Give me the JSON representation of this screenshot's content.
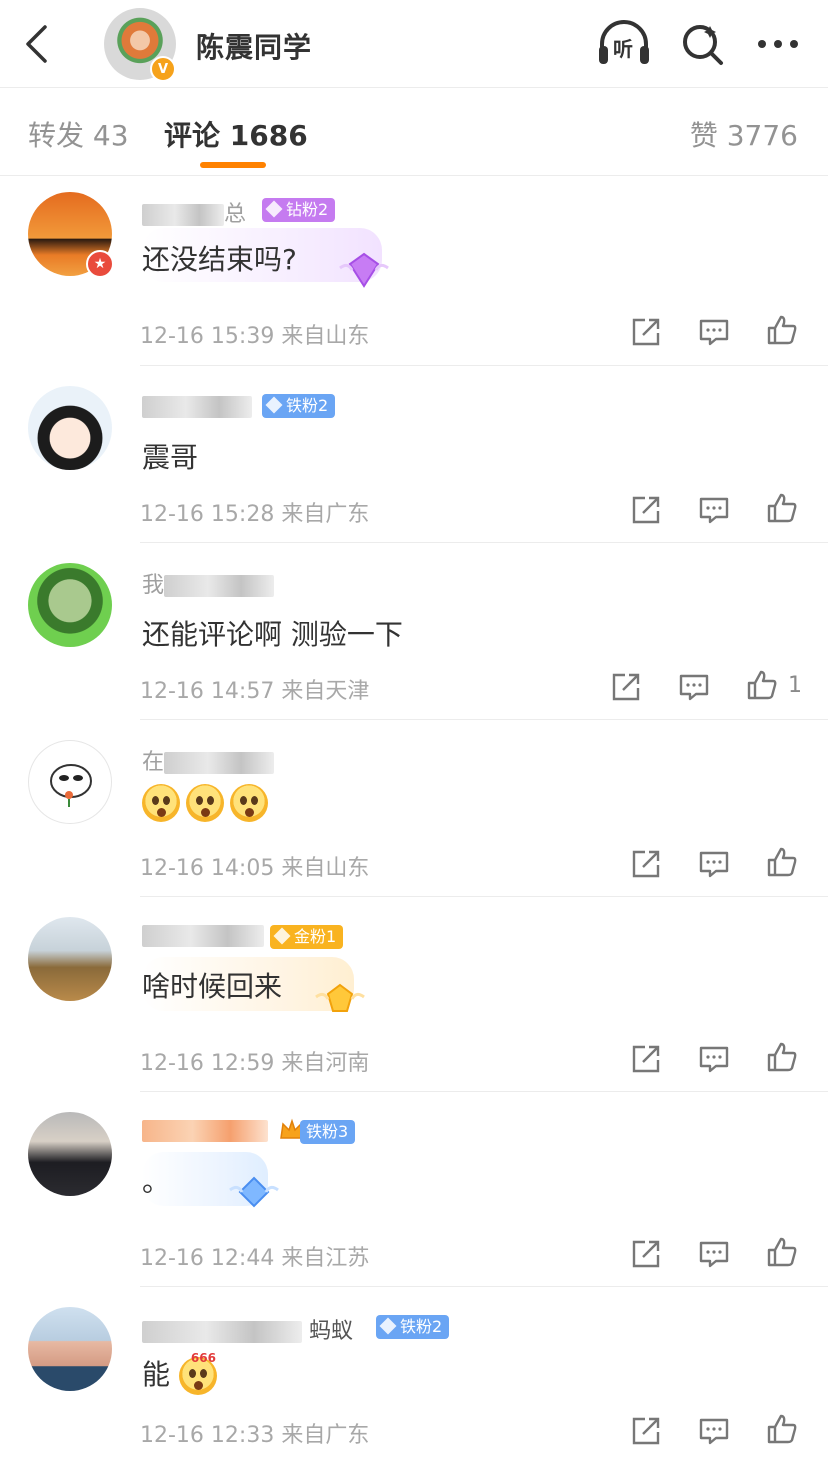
{
  "header": {
    "title": "陈震同学",
    "verified_badge": "V",
    "icons": [
      "back-icon",
      "listen-icon",
      "search-icon",
      "more-icon"
    ],
    "listen_label": "听"
  },
  "tabs": {
    "repost": "转发 43",
    "comments": "评论 1686",
    "likes": "赞 3776",
    "active": "comments",
    "accent": "#ff8200"
  },
  "comments": [
    {
      "name_prefix": "",
      "name_suffix": "总",
      "badge": "钻粉2",
      "badge_type": "diamond",
      "text": "还没结束吗?",
      "time": "12-16 15:39 来自山东",
      "likes": ""
    },
    {
      "name_prefix": "",
      "name_suffix": "",
      "badge": "铁粉2",
      "badge_type": "iron",
      "text": "震哥",
      "time": "12-16 15:28 来自广东",
      "likes": ""
    },
    {
      "name_prefix": "我",
      "name_suffix": "",
      "badge": "",
      "badge_type": "",
      "text": "还能评论啊 测验一下",
      "time": "12-16 14:57 来自天津",
      "likes": "1"
    },
    {
      "name_prefix": "在",
      "name_suffix": "",
      "badge": "",
      "badge_type": "",
      "text": "",
      "emojis": 3,
      "time": "12-16 14:05 来自山东",
      "likes": ""
    },
    {
      "name_prefix": "",
      "name_suffix": "",
      "badge": "金粉1",
      "badge_type": "gold",
      "text": "啥时候回来",
      "time": "12-16 12:59 来自河南",
      "likes": ""
    },
    {
      "name_prefix": "",
      "name_suffix": "",
      "badge": "铁粉3",
      "badge_type": "iron",
      "text": "。",
      "time": "12-16 12:44 来自江苏",
      "likes": ""
    },
    {
      "name_prefix": "",
      "name_suffix": "蚂蚁",
      "badge": "铁粉2",
      "badge_type": "iron",
      "text": "能",
      "emoji_label": "666",
      "time": "12-16 12:33 来自广东",
      "likes": ""
    }
  ],
  "colors": {
    "diamond_badge": "#c57bf0",
    "iron_badge": "#6aa5f4",
    "gold_badge": "#f9b320"
  }
}
